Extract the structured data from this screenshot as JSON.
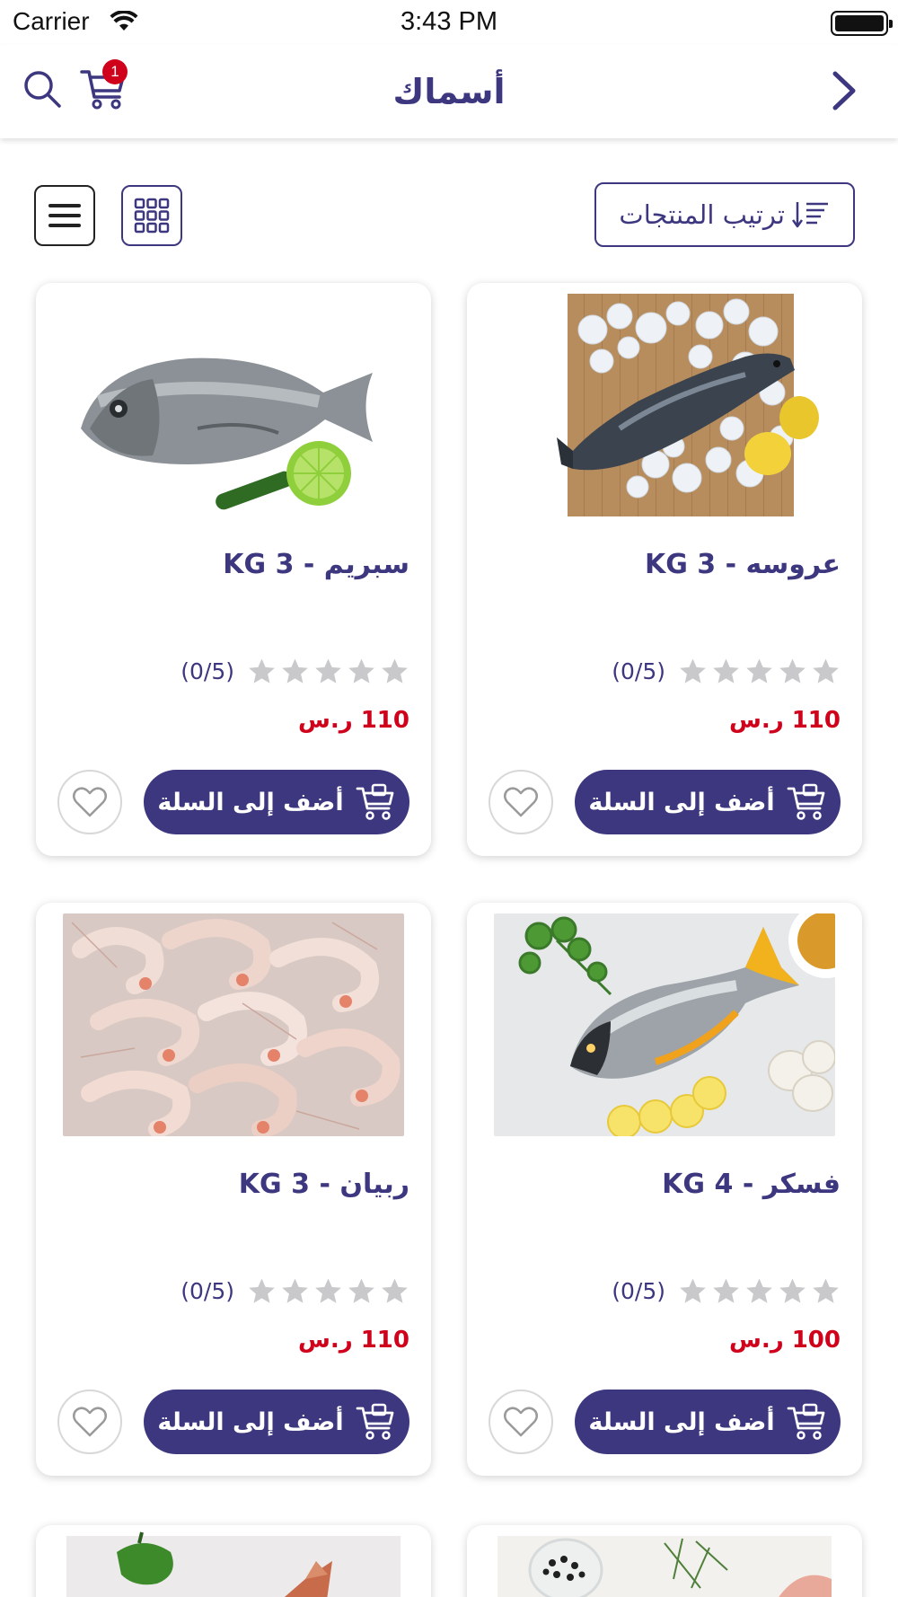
{
  "status_bar": {
    "carrier": "Carrier",
    "time": "3:43 PM"
  },
  "nav": {
    "title": "أسماك",
    "cart_count": "1"
  },
  "toolbar": {
    "sort_label": "ترتيب المنتجات"
  },
  "products": [
    {
      "name": "عروسه - KG 3",
      "rating": "(0/5)",
      "price": "110 ر.س",
      "add_label": "أضف إلى السلة",
      "image": "fish-on-ice-with-lemon"
    },
    {
      "name": "سبريم - KG 3",
      "rating": "(0/5)",
      "price": "110 ر.س",
      "add_label": "أضف إلى السلة",
      "image": "sea-bream-with-lime"
    },
    {
      "name": "فسكر - KG 4",
      "rating": "(0/5)",
      "price": "100 ر.س",
      "add_label": "أضف إلى السلة",
      "image": "fish-with-lemon-slices-and-garlic"
    },
    {
      "name": "ربيان - KG 3",
      "rating": "(0/5)",
      "price": "110 ر.س",
      "add_label": "أضف إلى السلة",
      "image": "raw-shrimp-pile"
    }
  ],
  "colors": {
    "primary": "#3d3780",
    "price": "#d0021b",
    "badge": "#d0021b",
    "star": "#c9c9cc"
  }
}
